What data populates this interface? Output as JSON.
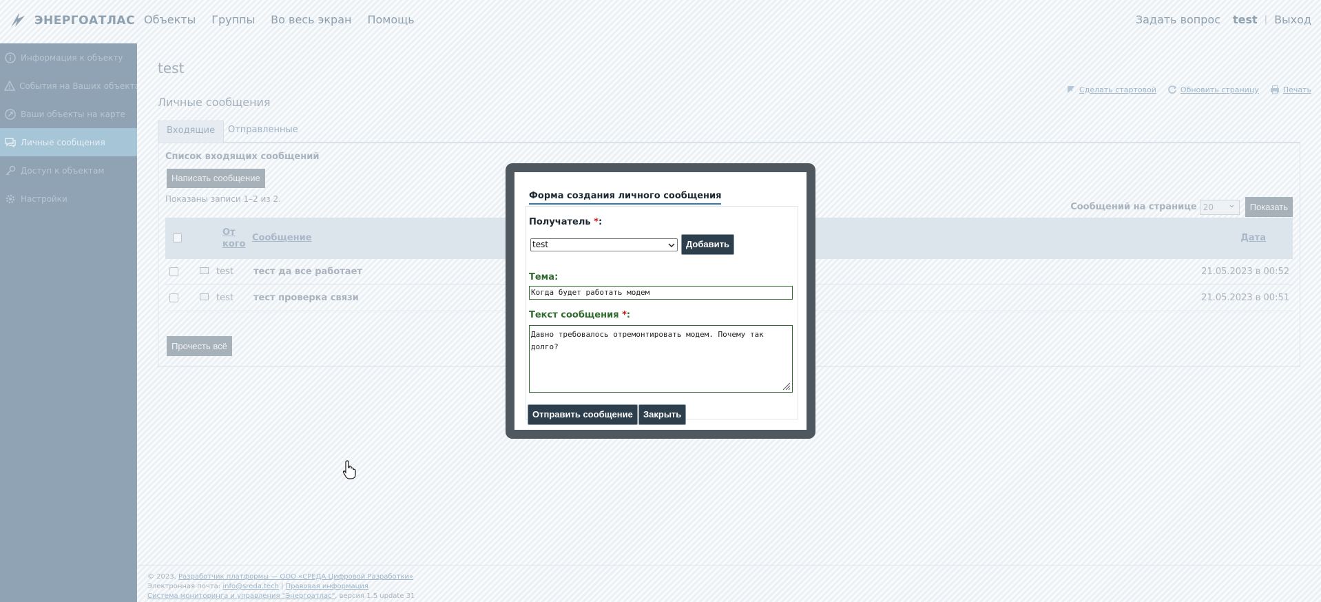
{
  "brand": {
    "name": "ЭНЕРГОАТЛАС"
  },
  "topnav": [
    "Объекты",
    "Группы",
    "Во весь экран",
    "Помощь"
  ],
  "topright": {
    "ask": "Задать вопрос",
    "user": "test",
    "sep": "|",
    "logout": "Выход"
  },
  "sidebar": {
    "items": [
      {
        "label": "Информация к объекту",
        "icon": "info-icon"
      },
      {
        "label": "События на Ваших объектах",
        "icon": "warning-icon"
      },
      {
        "label": "Ваши объекты на карте",
        "icon": "map-pin-icon"
      },
      {
        "label": "Личные сообщения",
        "icon": "chat-icon",
        "active": true
      },
      {
        "label": "Доступ к объектам",
        "icon": "key-icon"
      },
      {
        "label": "Настройки",
        "icon": "gear-icon"
      }
    ]
  },
  "page": {
    "title": "test",
    "section": "Личные сообщения"
  },
  "quicklinks": [
    "Сделать стартовой",
    "Обновить страницу",
    "Печать"
  ],
  "tabs": [
    "Входящие",
    "Отправленные"
  ],
  "inbox": {
    "title": "Список входящих сообщений",
    "write_button": "Написать сообщение",
    "shown": "Показаны записи 1–2 из 2.",
    "per_page_label": "Сообщений на странице",
    "per_page_value": "20",
    "show_button": "Показать",
    "read_all_button": "Прочесть всё",
    "columns": {
      "from_line1": "От",
      "from_line2": "кого",
      "message": "Сообщение",
      "date": "Дата"
    },
    "rows": [
      {
        "from": "test",
        "message": "тест да все работает",
        "date": "21.05.2023 в 00:52"
      },
      {
        "from": "test",
        "message": "тест проверка связи",
        "date": "21.05.2023 в 00:51"
      }
    ]
  },
  "footer": {
    "copyright": "© 2023,",
    "developer_link": "Разработчик платформы — ООО «СРЕДА Цифровой Разработки»",
    "email_label": "Электронная почта:",
    "email": "info@sreda.tech",
    "sep": "|",
    "legal": "Правовая информация",
    "system_link": "Система мониторинга и управления \"Энергоатлас\"",
    "version": ", версия 1.5 update 31"
  },
  "modal": {
    "tab_title": "Форма создания личного сообщения",
    "recipient_label": "Получатель",
    "required_mark": "*",
    "colon": ":",
    "recipient_value": "test",
    "add_button": "Добавить",
    "subject_label": "Тема:",
    "subject_value": "Когда будет работать модем",
    "body_label": "Текст сообщения",
    "body_value": "Давно требовалось отремонтировать модем. Почему так долго?",
    "send_button": "Отправить сообщение",
    "close_button": "Закрыть"
  },
  "colors": {
    "accent": "#2e7ab5",
    "sidebar": "#8fa3b4",
    "modal_frame": "#50585f",
    "dark_button": "#2d3e4d",
    "field_green": "#2f6a2f"
  }
}
